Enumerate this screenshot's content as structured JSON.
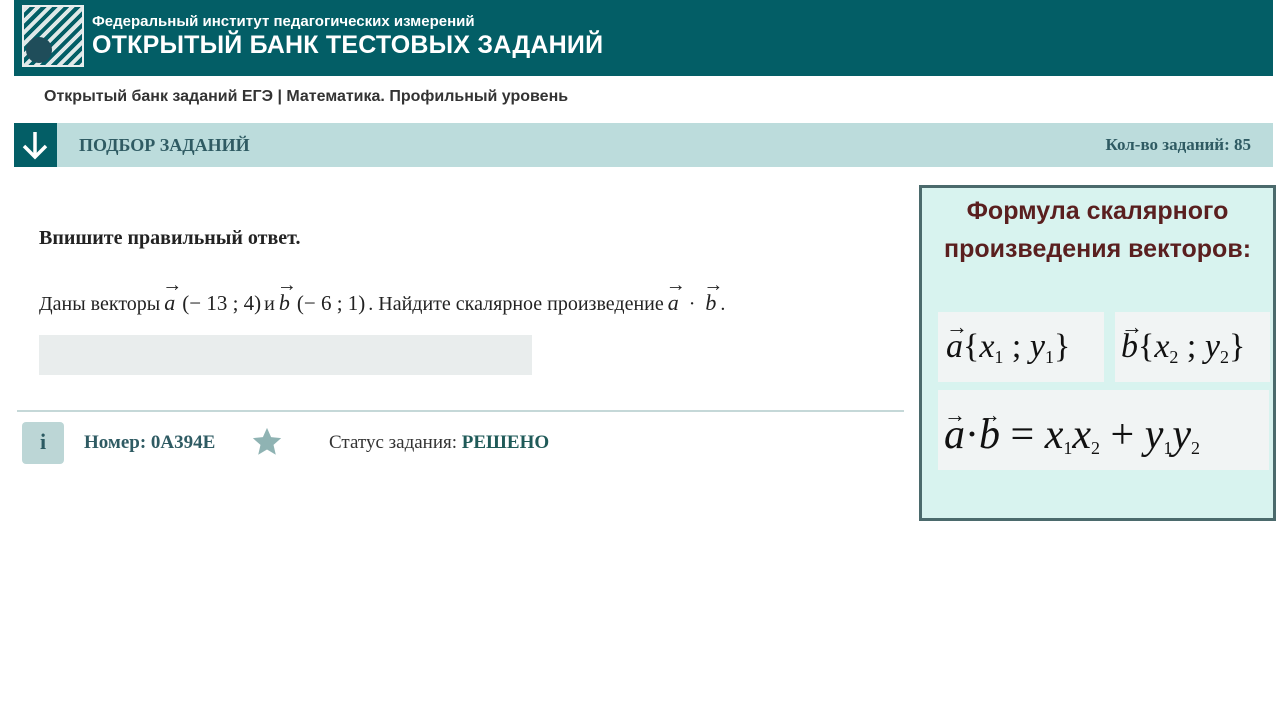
{
  "header": {
    "org": "Федеральный институт педагогических измерений",
    "title": "ОТКРЫТЫЙ БАНК ТЕСТОВЫХ ЗАДАНИЙ"
  },
  "breadcrumb": "Открытый банк заданий ЕГЭ | Математика. Профильный уровень",
  "selection_bar": {
    "label": "ПОДБОР ЗАДАНИЙ",
    "count": "Кол-во заданий: 85"
  },
  "task": {
    "instruction": "Впишите правильный ответ.",
    "given": "Даны векторы",
    "vec_a": "a",
    "vec_a_coords": "(− 13 ; 4)",
    "and": "и",
    "vec_b": "b",
    "vec_b_coords": "(− 6 ; 1)",
    "question": ". Найдите скалярное произведение",
    "dot": "·",
    "end": ".",
    "answer_value": ""
  },
  "footer": {
    "info": "i",
    "number": "Номер: 0А394Е",
    "status_label": "Статус задания:",
    "status_value": "РЕШЕНО"
  },
  "formula_panel": {
    "title": "Формула скалярного произведения векторов:",
    "a": "a",
    "b": "b",
    "x1": "1",
    "y1": "1",
    "x2": "2",
    "y2": "2"
  },
  "colors": {
    "header_bg": "#035e66",
    "selection_bar_bg": "#bcdcdc",
    "panel_bg": "#d8f3ef",
    "panel_title": "#5a1f1f"
  }
}
